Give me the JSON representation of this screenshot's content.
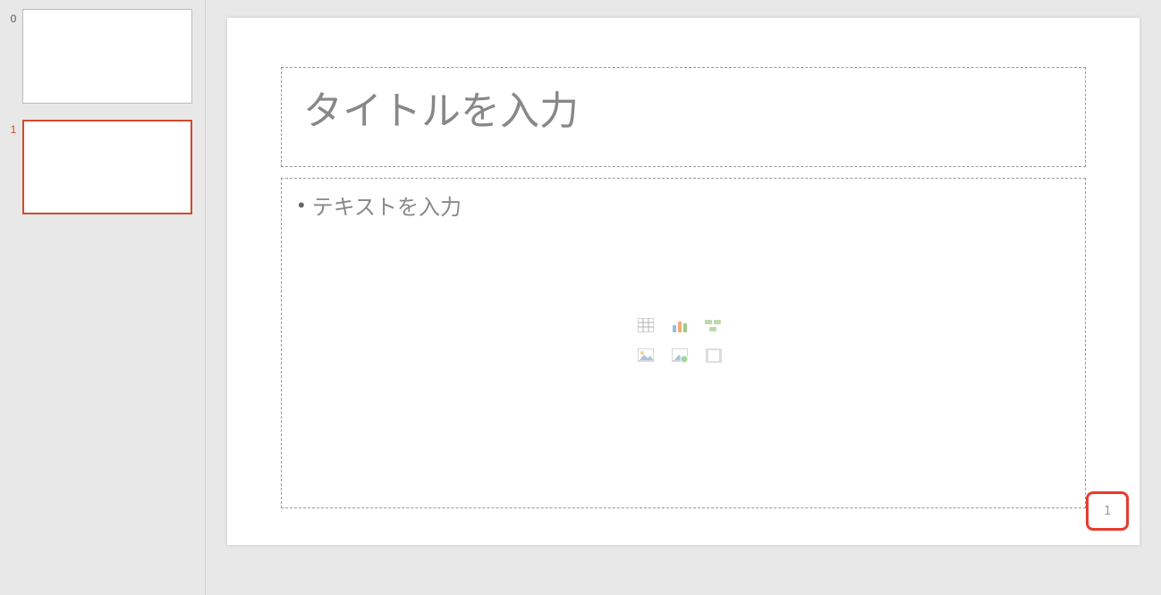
{
  "sidebar": {
    "thumbnails": [
      {
        "index": "0",
        "selected": false
      },
      {
        "index": "1",
        "selected": true
      }
    ]
  },
  "slide": {
    "title_placeholder": "タイトルを入力",
    "content_placeholder": "テキストを入力",
    "page_number": "1",
    "insert_icons": {
      "table": "table-icon",
      "chart": "chart-icon",
      "smartart": "smartart-icon",
      "picture": "picture-icon",
      "online_picture": "online-picture-icon",
      "video": "video-icon"
    }
  }
}
